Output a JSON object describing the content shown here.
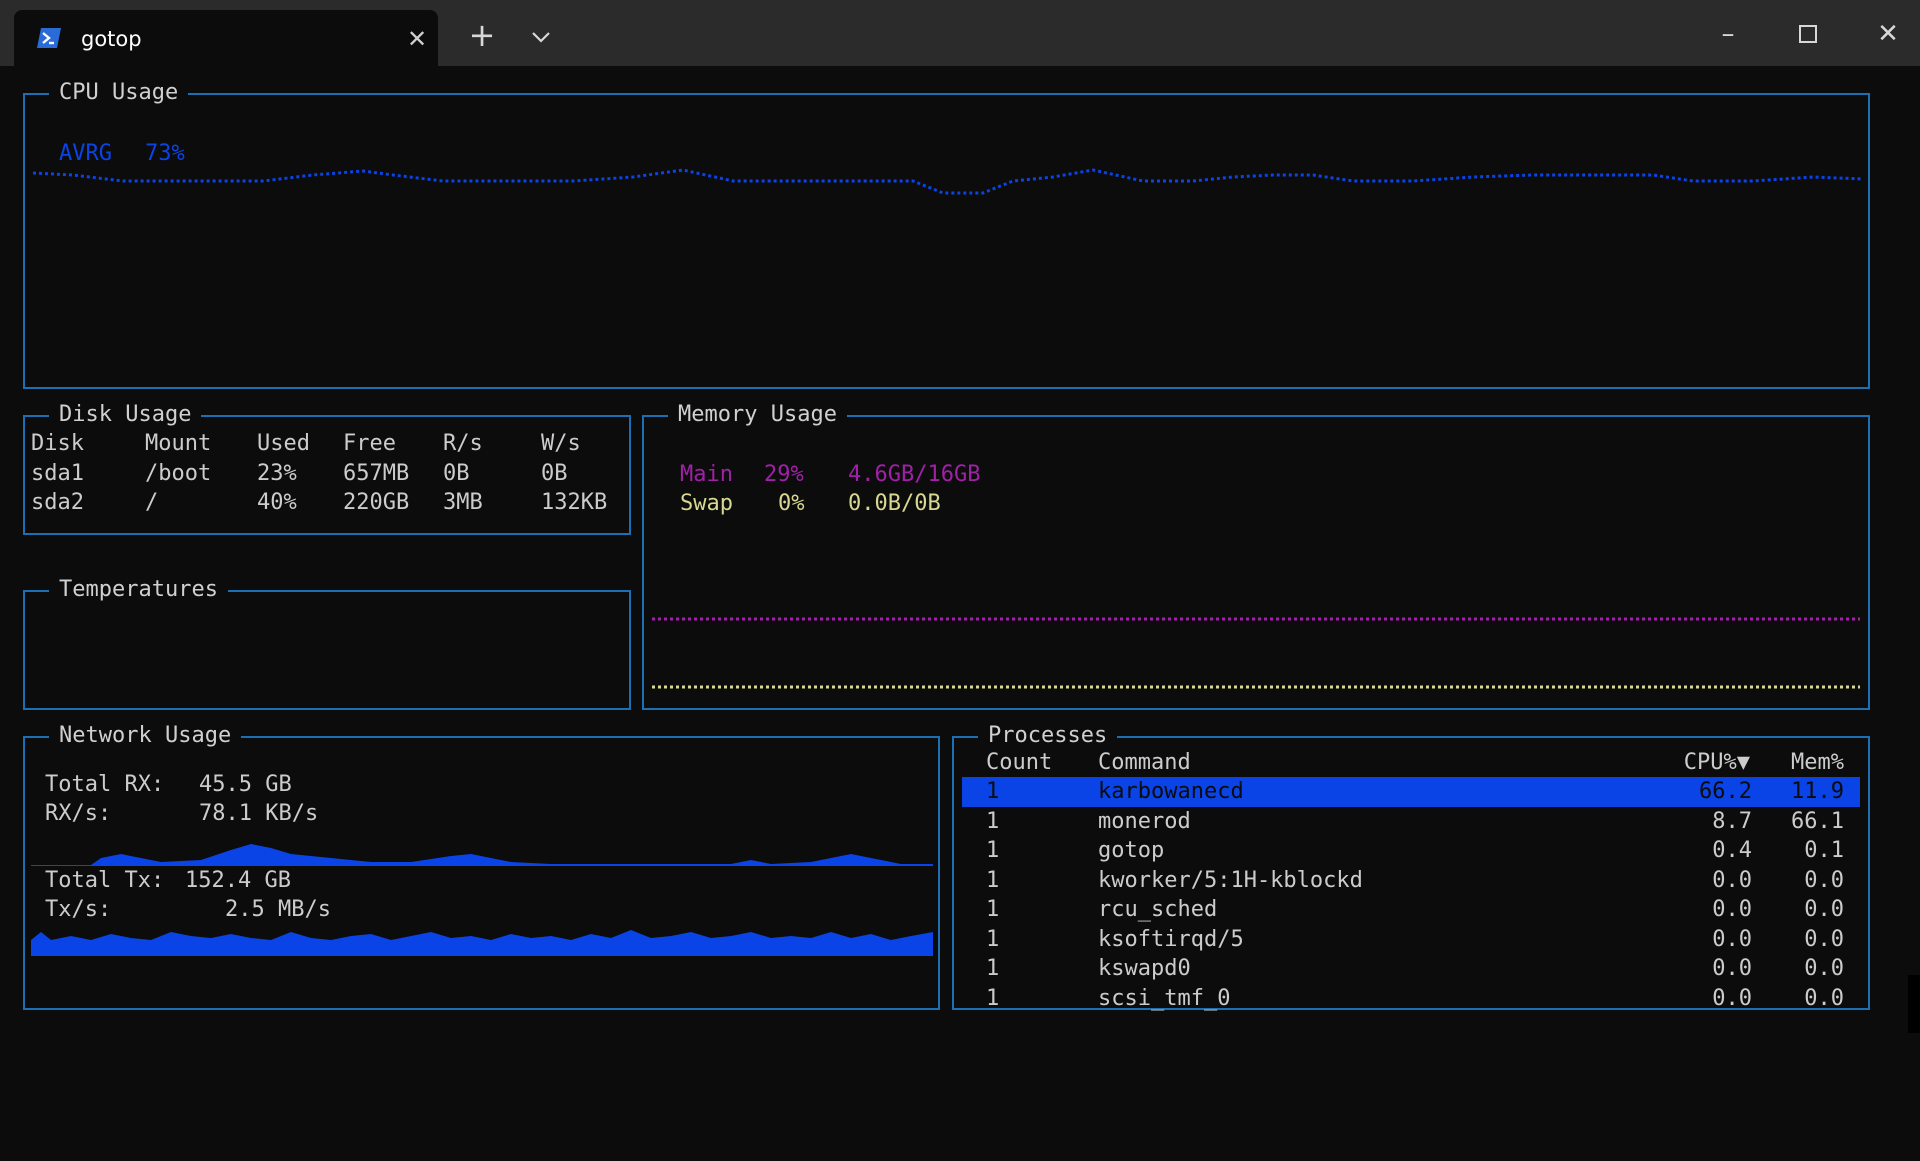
{
  "window": {
    "tab_title": "gotop",
    "tab_icon": "powershell-icon",
    "new_tab_icon": "plus-icon",
    "tab_menu_icon": "chevron-down-icon",
    "minimize": "–",
    "maximize": "☐",
    "close": "✕"
  },
  "colors": {
    "border": "#1d6fb3",
    "cpu_line": "#0a43e6",
    "memory_main": "#a020a8",
    "memory_swap": "#d8d890",
    "selection": "#0a43e6"
  },
  "cpu": {
    "title": "CPU Usage",
    "label": "AVRG",
    "value": "73%"
  },
  "disk": {
    "title": "Disk Usage",
    "columns": [
      "Disk",
      "Mount",
      "Used",
      "Free",
      "R/s",
      "W/s"
    ],
    "rows": [
      [
        "sda1",
        "/boot",
        "23%",
        "657MB",
        "0B",
        "0B"
      ],
      [
        "sda2",
        "/",
        "40%",
        "220GB",
        "3MB",
        "132KB"
      ]
    ]
  },
  "temperatures": {
    "title": "Temperatures"
  },
  "memory": {
    "title": "Memory Usage",
    "main": {
      "label": "Main",
      "percent": "29%",
      "amount": "4.6GB/16GB"
    },
    "swap": {
      "label": "Swap",
      "percent": "0%",
      "amount": "0.0B/0B"
    }
  },
  "network": {
    "title": "Network Usage",
    "total_rx_label": "Total RX:",
    "total_rx": "45.5 GB",
    "rx_rate_label": "RX/s:",
    "rx_rate": "78.1 KB/s",
    "total_tx_label": "Total Tx:",
    "total_tx": "152.4 GB",
    "tx_rate_label": "Tx/s:",
    "tx_rate": "2.5 MB/s"
  },
  "processes": {
    "title": "Processes",
    "columns": {
      "count": "Count",
      "command": "Command",
      "cpu": "CPU%▼",
      "mem": "Mem%"
    },
    "rows": [
      {
        "count": "1",
        "command": "karbowanecd",
        "cpu": "66.2",
        "mem": "11.9"
      },
      {
        "count": "1",
        "command": "monerod",
        "cpu": "8.7",
        "mem": "66.1"
      },
      {
        "count": "1",
        "command": "gotop",
        "cpu": "0.4",
        "mem": "0.1"
      },
      {
        "count": "1",
        "command": "kworker/5:1H-kblockd",
        "cpu": "0.0",
        "mem": "0.0"
      },
      {
        "count": "1",
        "command": "rcu_sched",
        "cpu": "0.0",
        "mem": "0.0"
      },
      {
        "count": "1",
        "command": "ksoftirqd/5",
        "cpu": "0.0",
        "mem": "0.0"
      },
      {
        "count": "1",
        "command": "kswapd0",
        "cpu": "0.0",
        "mem": "0.0"
      },
      {
        "count": "1",
        "command": "scsi_tmf_0",
        "cpu": "0.0",
        "mem": "0.0"
      }
    ]
  }
}
